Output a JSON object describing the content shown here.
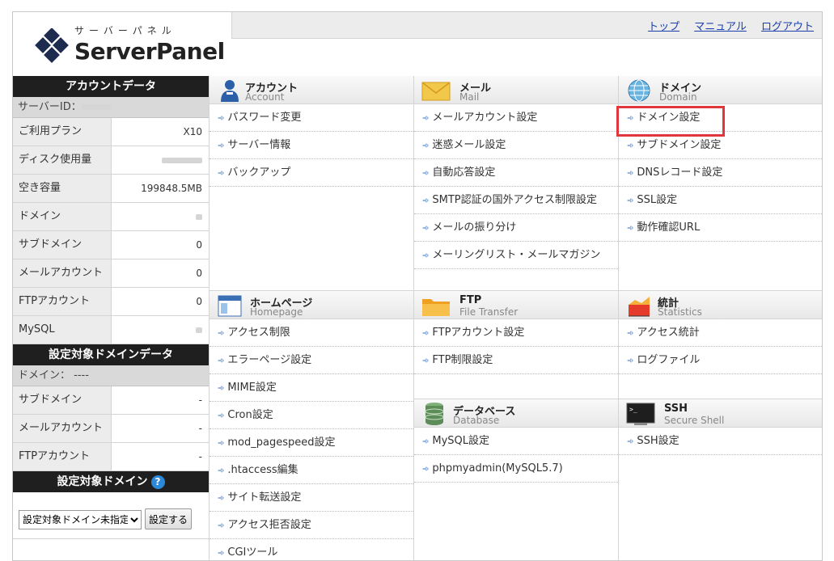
{
  "header": {
    "logo_sub": "サーバーパネル",
    "logo_main": "ServerPanel",
    "links": [
      "トップ",
      "マニュアル",
      "ログアウト"
    ]
  },
  "sidebar": {
    "account_title": "アカウントデータ",
    "server_id_label": "サーバーID：",
    "account_rows": [
      {
        "label": "ご利用プラン",
        "value": "X10"
      },
      {
        "label": "ディスク使用量",
        "value": ""
      },
      {
        "label": "空き容量",
        "value": "199848.5MB"
      },
      {
        "label": "ドメイン",
        "value": ""
      },
      {
        "label": "サブドメイン",
        "value": "0"
      },
      {
        "label": "メールアカウント",
        "value": "0"
      },
      {
        "label": "FTPアカウント",
        "value": "0"
      },
      {
        "label": "MySQL",
        "value": ""
      }
    ],
    "domain_title": "設定対象ドメインデータ",
    "domain_label": "ドメイン： ----",
    "domain_rows": [
      {
        "label": "サブドメイン",
        "value": "-"
      },
      {
        "label": "メールアカウント",
        "value": "-"
      },
      {
        "label": "FTPアカウント",
        "value": "-"
      }
    ],
    "target_title": "設定対象ドメイン",
    "help_icon": "?",
    "select_value": "設定対象ドメイン未指定",
    "set_button": "設定する"
  },
  "panels": {
    "account": {
      "title": "アカウント",
      "subtitle": "Account",
      "items": [
        "パスワード変更",
        "サーバー情報",
        "バックアップ"
      ]
    },
    "mail": {
      "title": "メール",
      "subtitle": "Mail",
      "items": [
        "メールアカウント設定",
        "迷惑メール設定",
        "自動応答設定",
        "SMTP認証の国外アクセス制限設定",
        "メールの振り分け",
        "メーリングリスト・メールマガジン"
      ]
    },
    "domain": {
      "title": "ドメイン",
      "subtitle": "Domain",
      "items": [
        "ドメイン設定",
        "サブドメイン設定",
        "DNSレコード設定",
        "SSL設定",
        "動作確認URL"
      ]
    },
    "homepage": {
      "title": "ホームページ",
      "subtitle": "Homepage",
      "items": [
        "アクセス制限",
        "エラーページ設定",
        "MIME設定",
        "Cron設定",
        "mod_pagespeed設定",
        ".htaccess編集",
        "サイト転送設定",
        "アクセス拒否設定",
        "CGIツール"
      ]
    },
    "ftp": {
      "title": "FTP",
      "subtitle": "File Transfer",
      "items": [
        "FTPアカウント設定",
        "FTP制限設定"
      ]
    },
    "stats": {
      "title": "統計",
      "subtitle": "Statistics",
      "items": [
        "アクセス統計",
        "ログファイル"
      ]
    },
    "database": {
      "title": "データベース",
      "subtitle": "Database",
      "items": [
        "MySQL設定",
        "phpmyadmin(MySQL5.7)"
      ]
    },
    "ssh": {
      "title": "SSH",
      "subtitle": "Secure Shell",
      "items": [
        "SSH設定"
      ]
    }
  },
  "colors": {
    "highlight": "#e0373d",
    "link": "#1a3faa",
    "dark_header": "#1f1f1f",
    "arrow": "#2d6fc7"
  }
}
